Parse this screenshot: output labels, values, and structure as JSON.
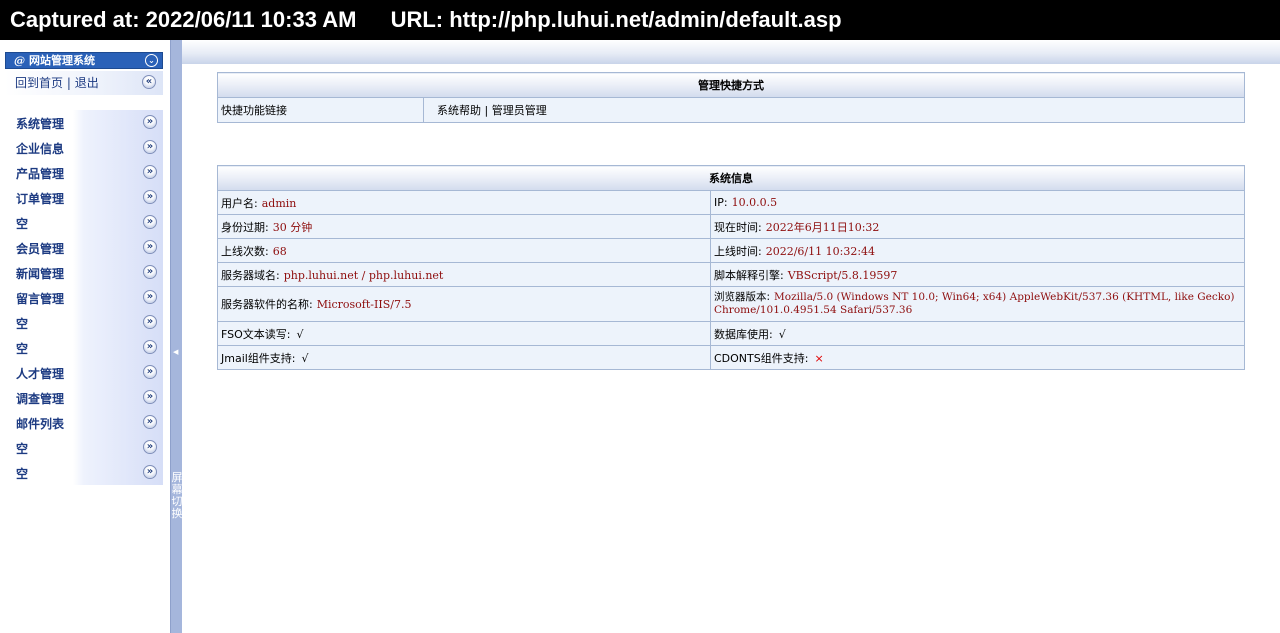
{
  "capture": {
    "captured_at": "Captured at: 2022/06/11 10:33 AM",
    "url": "URL: http://php.luhui.net/admin/default.asp"
  },
  "sidebar": {
    "title": "网站管理系统",
    "home_link": "回到首页",
    "separator": "|",
    "logout_link": "退出",
    "items": [
      {
        "label": "系统管理"
      },
      {
        "label": "企业信息"
      },
      {
        "label": "产品管理"
      },
      {
        "label": "订单管理"
      },
      {
        "label": "空"
      },
      {
        "label": "会员管理"
      },
      {
        "label": "新闻管理"
      },
      {
        "label": "留言管理"
      },
      {
        "label": "空"
      },
      {
        "label": "空"
      },
      {
        "label": "人才管理"
      },
      {
        "label": "调查管理"
      },
      {
        "label": "邮件列表"
      },
      {
        "label": "空"
      },
      {
        "label": "空"
      }
    ]
  },
  "splitter": {
    "label": "屏幕切换"
  },
  "shortcuts": {
    "title": "管理快捷方式",
    "row_label": "快捷功能链接",
    "link1": "系统帮助",
    "separator": "|",
    "link2": "管理员管理"
  },
  "sysinfo": {
    "title": "系统信息",
    "username_label": "用户名:",
    "username": "admin",
    "ip_label": "IP:",
    "ip": "10.0.0.5",
    "expire_label": "身份过期:",
    "expire": "30 分钟",
    "now_label": "现在时间:",
    "now": "2022年6月11日10:32",
    "login_count_label": "上线次数:",
    "login_count": "68",
    "login_time_label": "上线时间:",
    "login_time": "2022/6/11 10:32:44",
    "domain_label": "服务器域名:",
    "domain": "php.luhui.net / php.luhui.net",
    "script_engine_label": "脚本解释引擎:",
    "script_engine": "VBScript/5.8.19597",
    "server_software_label": "服务器软件的名称:",
    "server_software": "Microsoft-IIS/7.5",
    "browser_label": "浏览器版本:",
    "browser": "Mozilla/5.0 (Windows NT 10.0; Win64; x64) AppleWebKit/537.36 (KHTML, like Gecko) Chrome/101.0.4951.54 Safari/537.36",
    "fso_label": "FSO文本读写:",
    "fso": "√",
    "db_label": "数据库使用:",
    "db": "√",
    "jmail_label": "Jmail组件支持:",
    "jmail": "√",
    "cdonts_label": "CDONTS组件支持:",
    "cdonts": "×"
  }
}
